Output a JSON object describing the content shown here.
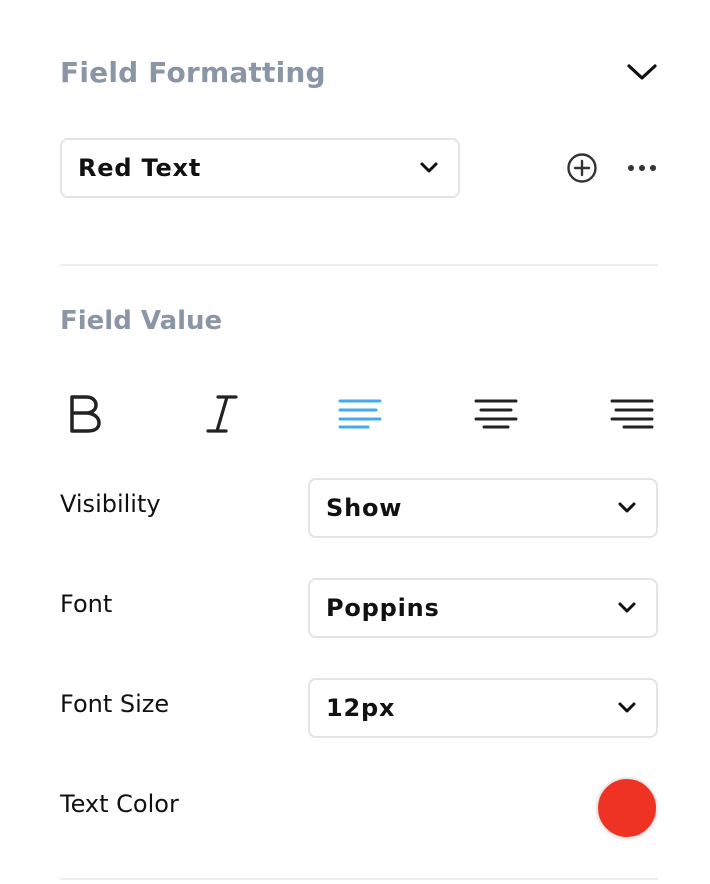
{
  "field_formatting": {
    "title": "Field Formatting",
    "collapse_icon": "chevron-down-icon",
    "selected_format": "Red Text",
    "add_icon": "plus-circle-icon",
    "more_icon": "more-horizontal-icon"
  },
  "field_value": {
    "title": "Field Value",
    "toolbar": [
      "bold-icon",
      "italic-icon",
      "align-left-icon",
      "align-center-icon",
      "align-right-icon"
    ],
    "active_alignment": "left",
    "accent_color": "#46a8f0",
    "visibility": {
      "label": "Visibility",
      "value": "Show"
    },
    "font": {
      "label": "Font",
      "value": "Poppins"
    },
    "font_size": {
      "label": "Font Size",
      "value": "12px"
    },
    "text_color": {
      "label": "Text Color",
      "value": "#ee3325"
    }
  }
}
